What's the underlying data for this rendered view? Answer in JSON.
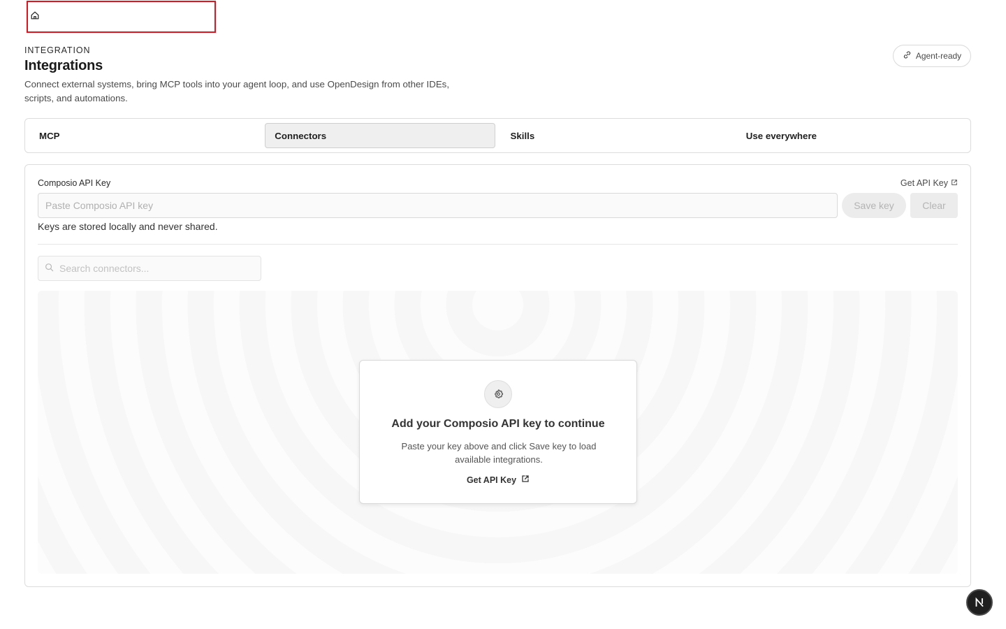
{
  "header": {
    "eyebrow": "INTEGRATION",
    "title": "Integrations",
    "description": "Connect external systems, bring MCP tools into your agent loop, and use OpenDesign from other IDEs, scripts, and automations.",
    "badge_label": "Agent-ready"
  },
  "tabs": [
    {
      "label": "MCP",
      "active": false
    },
    {
      "label": "Connectors",
      "active": true
    },
    {
      "label": "Skills",
      "active": false
    },
    {
      "label": "Use everywhere",
      "active": false
    }
  ],
  "api_key": {
    "label": "Composio API Key",
    "get_key_label": "Get API Key",
    "placeholder": "Paste Composio API key",
    "value": "",
    "save_label": "Save key",
    "clear_label": "Clear",
    "hint": "Keys are stored locally and never shared."
  },
  "search": {
    "placeholder": "Search connectors...",
    "value": ""
  },
  "empty_state": {
    "title": "Add your Composio API key to continue",
    "description": "Paste your key above and click Save key to load available integrations.",
    "link_label": "Get API Key"
  },
  "icons": {
    "home": "home-icon",
    "link": "link-icon",
    "external": "external-link-icon",
    "search": "search-icon",
    "gear": "gear-icon",
    "next": "nextjs-logo-icon"
  },
  "colors": {
    "highlight_box": "#e0141e",
    "active_tab_bg": "#efefef",
    "disabled_button_bg": "#ececec",
    "disabled_button_text": "#b4b4b4",
    "badge_bg": "#1f1f1f"
  }
}
